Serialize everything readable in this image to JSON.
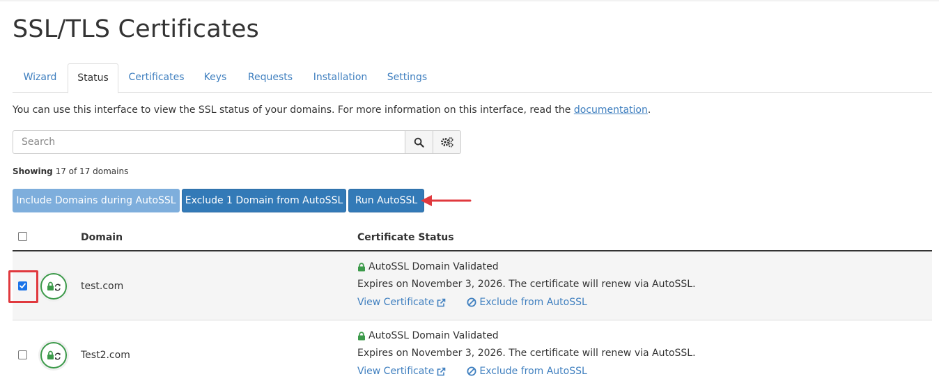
{
  "page": {
    "title": "SSL/TLS Certificates"
  },
  "tabs": [
    {
      "label": "Wizard"
    },
    {
      "label": "Status"
    },
    {
      "label": "Certificates"
    },
    {
      "label": "Keys"
    },
    {
      "label": "Requests"
    },
    {
      "label": "Installation"
    },
    {
      "label": "Settings"
    }
  ],
  "active_tab": "Status",
  "intro": {
    "text": "You can use this interface to view the SSL status of your domains. For more information on this interface, read the ",
    "link": "documentation",
    "suffix": "."
  },
  "search": {
    "placeholder": "Search",
    "value": ""
  },
  "showing": {
    "label": "Showing",
    "text": "17 of 17 domains"
  },
  "actions": {
    "include_label": "Include Domains during AutoSSL",
    "exclude_label": "Exclude 1 Domain from AutoSSL",
    "run_label": "Run AutoSSL"
  },
  "table": {
    "headers": {
      "domain": "Domain",
      "status": "Certificate Status"
    },
    "rows": [
      {
        "checked": true,
        "domain": "test.com",
        "status": "AutoSSL Domain Validated",
        "expires": "Expires on November 3, 2026. The certificate will renew via AutoSSL.",
        "view_label": "View Certificate",
        "exclude_label": "Exclude from AutoSSL"
      },
      {
        "checked": false,
        "domain": "Test2.com",
        "status": "AutoSSL Domain Validated",
        "expires": "Expires on November 3, 2026. The certificate will renew via AutoSSL.",
        "view_label": "View Certificate",
        "exclude_label": "Exclude from AutoSSL"
      }
    ]
  },
  "colors": {
    "link": "#3f7fbf",
    "primary_button": "#337ab7",
    "disabled_button": "#7eaedc",
    "success": "#3c9a4a",
    "annotation": "#e0393e"
  },
  "icons": {
    "search": "search-icon",
    "settings": "gears-icon",
    "lock": "lock-icon",
    "external": "external-link-icon",
    "ban": "ban-icon"
  }
}
